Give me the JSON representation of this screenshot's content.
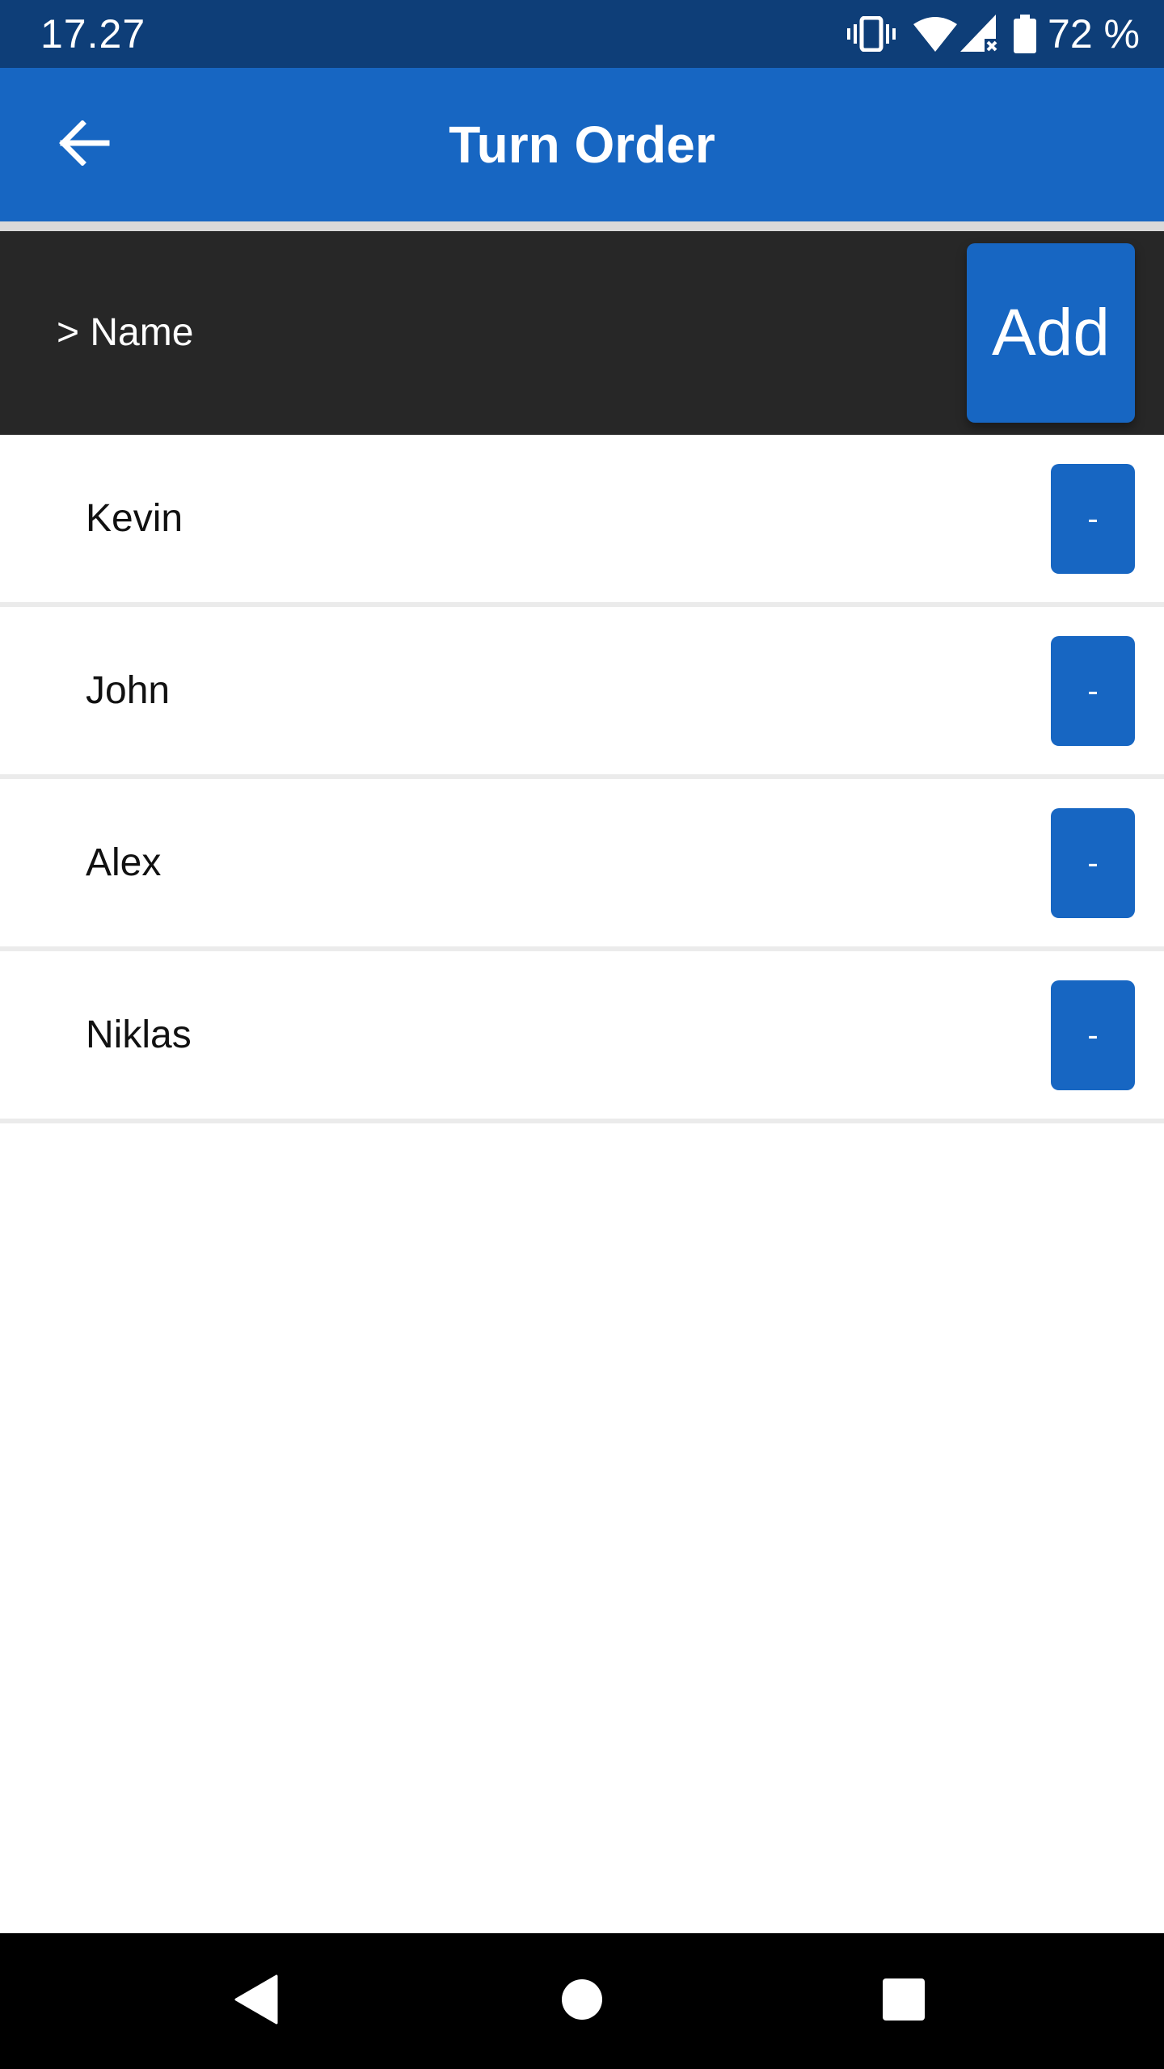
{
  "status_bar": {
    "time": "17.27",
    "battery_percent": "72 %",
    "icons": [
      "vibrate-icon",
      "wifi-icon",
      "cell-signal-icon",
      "battery-icon"
    ]
  },
  "app_bar": {
    "title": "Turn Order",
    "back_icon": "arrow-left-icon"
  },
  "input_row": {
    "placeholder": "> Name",
    "add_label": "Add"
  },
  "players": [
    {
      "name": "Kevin",
      "remove_label": "-"
    },
    {
      "name": "John",
      "remove_label": "-"
    },
    {
      "name": "Alex",
      "remove_label": "-"
    },
    {
      "name": "Niklas",
      "remove_label": "-"
    }
  ],
  "nav_bar": {
    "icons": [
      "nav-back-icon",
      "nav-home-icon",
      "nav-recents-icon"
    ]
  },
  "colors": {
    "status_bar": "#0e3e78",
    "app_bar": "#1766c2",
    "input_row": "#272727",
    "button": "#1766c2",
    "nav_bar": "#000000"
  }
}
